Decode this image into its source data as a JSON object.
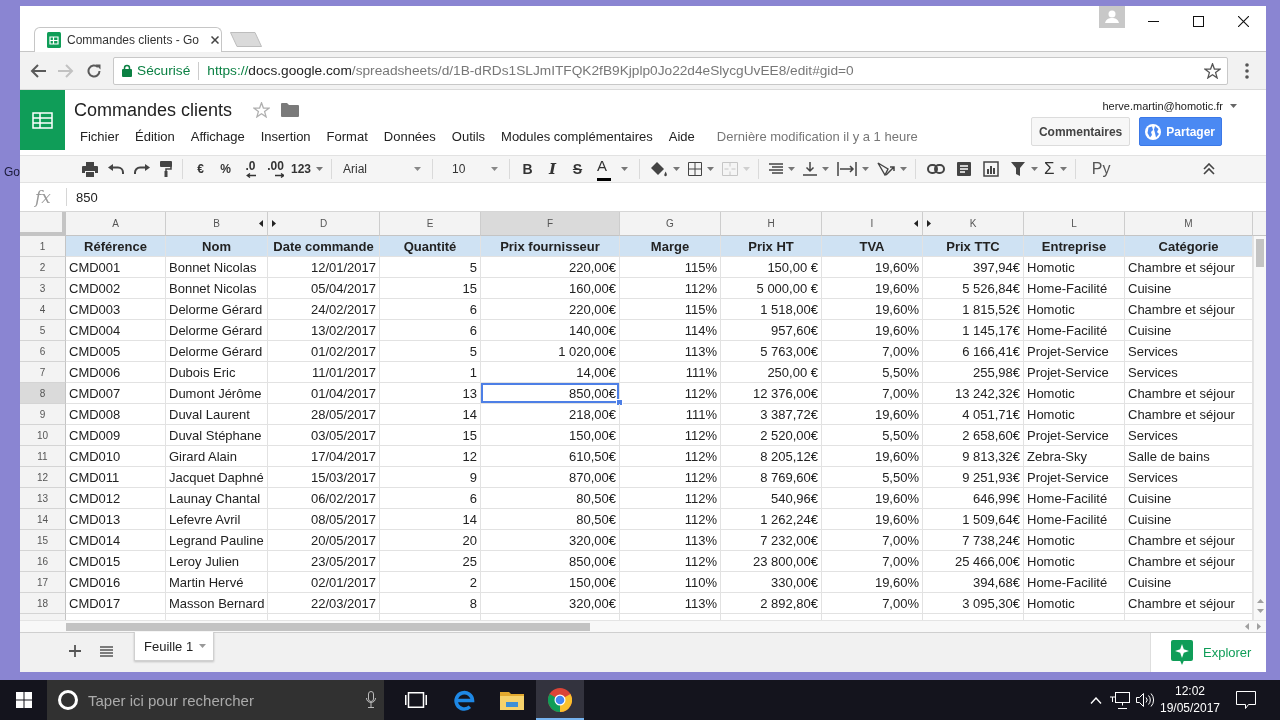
{
  "desktop": {
    "labels": [
      "Go"
    ]
  },
  "browser": {
    "tab": {
      "title": "Commandes clients - Go"
    },
    "forward_disabled": true,
    "security_label": "Sécurisé",
    "url": {
      "scheme": "https://",
      "host": "docs.google.com",
      "path": "/spreadsheets/d/1B-dRDs1SLJmITFQK2fB9Kjplp0Jo22d4eSlycgUvEE8/edit#gid=0"
    }
  },
  "document": {
    "title": "Commandes clients",
    "account": "herve.martin@homotic.fr",
    "menu": [
      "Fichier",
      "Édition",
      "Affichage",
      "Insertion",
      "Format",
      "Données",
      "Outils",
      "Modules complémentaires",
      "Aide"
    ],
    "last_edit": "Dernière modification il y a 1 heure",
    "comments_button": "Commentaires",
    "share_button": "Partager"
  },
  "toolbar": {
    "number_formats": [
      {
        "label": "€",
        "kind": "plain"
      },
      {
        "label": "%",
        "kind": "plain"
      },
      {
        "label": ".0",
        "kind": "decrease"
      },
      {
        "label": ".00",
        "kind": "increase"
      },
      {
        "label": "123",
        "kind": "menu"
      }
    ],
    "font": "Arial",
    "font_size": "10",
    "text_styles": [
      {
        "label": "B",
        "kind": "bold"
      },
      {
        "label": "I",
        "kind": "italic"
      },
      {
        "label": "S",
        "kind": "strike"
      },
      {
        "label": "A",
        "kind": "color"
      }
    ],
    "merge_disabled": true,
    "function_label": "Σ",
    "script_label": "Py"
  },
  "formula_bar": {
    "label": "fx",
    "value": "850"
  },
  "sheet": {
    "columns": [
      {
        "letter": "A",
        "kind": "text",
        "selected": false,
        "hidden_before": false,
        "hidden_after": false
      },
      {
        "letter": "B",
        "kind": "text",
        "selected": false,
        "hidden_before": false,
        "hidden_after": true
      },
      {
        "letter": "D",
        "kind": "number",
        "selected": false,
        "hidden_before": true,
        "hidden_after": false
      },
      {
        "letter": "E",
        "kind": "number",
        "selected": false,
        "hidden_before": false,
        "hidden_after": false
      },
      {
        "letter": "F",
        "kind": "number",
        "selected": true,
        "hidden_before": false,
        "hidden_after": false
      },
      {
        "letter": "G",
        "kind": "number",
        "selected": false,
        "hidden_before": false,
        "hidden_after": false
      },
      {
        "letter": "H",
        "kind": "number",
        "selected": false,
        "hidden_before": false,
        "hidden_after": false
      },
      {
        "letter": "I",
        "kind": "number",
        "selected": false,
        "hidden_before": false,
        "hidden_after": true
      },
      {
        "letter": "K",
        "kind": "number",
        "selected": false,
        "hidden_before": true,
        "hidden_after": false
      },
      {
        "letter": "L",
        "kind": "text",
        "selected": false,
        "hidden_before": false,
        "hidden_after": false
      },
      {
        "letter": "M",
        "kind": "text",
        "selected": false,
        "hidden_before": false,
        "hidden_after": false
      }
    ],
    "rows": [
      {
        "number": "1",
        "kind": "header",
        "selected": false,
        "cells": [
          "Référence",
          "Nom",
          "Date commande",
          "Quantité",
          "Prix fournisseur",
          "Marge",
          "Prix HT",
          "TVA",
          "Prix TTC",
          "Entreprise",
          "Catégorie"
        ]
      },
      {
        "number": "2",
        "kind": "data",
        "selected": false,
        "cells": [
          "CMD001",
          "Bonnet Nicolas",
          "12/01/2017",
          "5",
          "220,00€",
          "115%",
          "150,00 €",
          "19,60%",
          "397,94€",
          "Homotic",
          "Chambre et séjour"
        ]
      },
      {
        "number": "3",
        "kind": "data",
        "selected": false,
        "cells": [
          "CMD002",
          "Bonnet Nicolas",
          "05/04/2017",
          "15",
          "160,00€",
          "112%",
          "5 000,00 €",
          "19,60%",
          "5 526,84€",
          "Home-Facilité",
          "Cuisine"
        ]
      },
      {
        "number": "4",
        "kind": "data",
        "selected": false,
        "cells": [
          "CMD003",
          "Delorme Gérard",
          "24/02/2017",
          "6",
          "220,00€",
          "115%",
          "1 518,00€",
          "19,60%",
          "1 815,52€",
          "Homotic",
          "Chambre et séjour"
        ]
      },
      {
        "number": "5",
        "kind": "data",
        "selected": false,
        "cells": [
          "CMD004",
          "Delorme Gérard",
          "13/02/2017",
          "6",
          "140,00€",
          "114%",
          "957,60€",
          "19,60%",
          "1 145,17€",
          "Home-Facilité",
          "Cuisine"
        ]
      },
      {
        "number": "6",
        "kind": "data",
        "selected": false,
        "cells": [
          "CMD005",
          "Delorme Gérard",
          "01/02/2017",
          "5",
          "1 020,00€",
          "113%",
          "5 763,00€",
          "7,00%",
          "6 166,41€",
          "Projet-Service",
          "Services"
        ]
      },
      {
        "number": "7",
        "kind": "data",
        "selected": false,
        "cells": [
          "CMD006",
          "Dubois Eric",
          "11/01/2017",
          "1",
          "14,00€",
          "111%",
          "250,00 €",
          "5,50%",
          "255,98€",
          "Projet-Service",
          "Services"
        ]
      },
      {
        "number": "8",
        "kind": "data",
        "selected": true,
        "cells": [
          "CMD007",
          "Dumont Jérôme",
          "01/04/2017",
          "13",
          "850,00€",
          "112%",
          "12 376,00€",
          "7,00%",
          "13 242,32€",
          "Homotic",
          "Chambre et séjour"
        ]
      },
      {
        "number": "9",
        "kind": "data",
        "selected": false,
        "cells": [
          "CMD008",
          "Duval Laurent",
          "28/05/2017",
          "14",
          "218,00€",
          "111%",
          "3 387,72€",
          "19,60%",
          "4 051,71€",
          "Homotic",
          "Chambre et séjour"
        ]
      },
      {
        "number": "10",
        "kind": "data",
        "selected": false,
        "cells": [
          "CMD009",
          "Duval Stéphane",
          "03/05/2017",
          "15",
          "150,00€",
          "112%",
          "2 520,00€",
          "5,50%",
          "2 658,60€",
          "Projet-Service",
          "Services"
        ]
      },
      {
        "number": "11",
        "kind": "data",
        "selected": false,
        "cells": [
          "CMD010",
          "Girard Alain",
          "17/04/2017",
          "12",
          "610,50€",
          "112%",
          "8 205,12€",
          "19,60%",
          "9 813,32€",
          "Zebra-Sky",
          "Salle de bains"
        ]
      },
      {
        "number": "12",
        "kind": "data",
        "selected": false,
        "cells": [
          "CMD011",
          "Jacquet Daphné",
          "15/03/2017",
          "9",
          "870,00€",
          "112%",
          "8 769,60€",
          "5,50%",
          "9 251,93€",
          "Projet-Service",
          "Services"
        ]
      },
      {
        "number": "13",
        "kind": "data",
        "selected": false,
        "cells": [
          "CMD012",
          "Launay Chantal",
          "06/02/2017",
          "6",
          "80,50€",
          "112%",
          "540,96€",
          "19,60%",
          "646,99€",
          "Home-Facilité",
          "Cuisine"
        ]
      },
      {
        "number": "14",
        "kind": "data",
        "selected": false,
        "cells": [
          "CMD013",
          "Lefevre Avril",
          "08/05/2017",
          "14",
          "80,50€",
          "112%",
          "1 262,24€",
          "19,60%",
          "1 509,64€",
          "Home-Facilité",
          "Cuisine"
        ]
      },
      {
        "number": "15",
        "kind": "data",
        "selected": false,
        "cells": [
          "CMD014",
          "Legrand Pauline",
          "20/05/2017",
          "20",
          "320,00€",
          "113%",
          "7 232,00€",
          "7,00%",
          "7 738,24€",
          "Homotic",
          "Chambre et séjour"
        ]
      },
      {
        "number": "16",
        "kind": "data",
        "selected": false,
        "cells": [
          "CMD015",
          "Leroy Julien",
          "23/05/2017",
          "25",
          "850,00€",
          "112%",
          "23 800,00€",
          "7,00%",
          "25 466,00€",
          "Homotic",
          "Chambre et séjour"
        ]
      },
      {
        "number": "17",
        "kind": "data",
        "selected": false,
        "cells": [
          "CMD016",
          "Martin Hervé",
          "02/01/2017",
          "2",
          "150,00€",
          "110%",
          "330,00€",
          "19,60%",
          "394,68€",
          "Home-Facilité",
          "Cuisine"
        ]
      },
      {
        "number": "18",
        "kind": "data",
        "selected": false,
        "cells": [
          "CMD017",
          "Masson Bernard",
          "22/03/2017",
          "8",
          "320,00€",
          "113%",
          "2 892,80€",
          "7,00%",
          "3 095,30€",
          "Homotic",
          "Chambre et séjour"
        ]
      }
    ]
  },
  "sheet_tabs": [
    {
      "name": "Feuille 1",
      "selected": true
    }
  ],
  "explore_button": "Explorer",
  "taskbar": {
    "search_placeholder": "Taper ici pour rechercher",
    "apps": [
      {
        "selected": false
      },
      {
        "selected": false
      },
      {
        "selected": true
      }
    ],
    "time": "12:02",
    "date": "19/05/2017"
  }
}
